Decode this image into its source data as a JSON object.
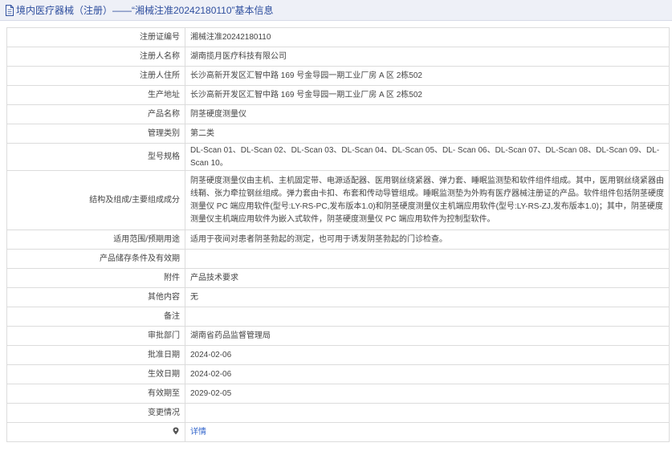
{
  "header": {
    "title": "境内医疗器械（注册）——“湘械注准20242180110”基本信息"
  },
  "rows": [
    {
      "label": "注册证编号",
      "value": "湘械注准20242180110"
    },
    {
      "label": "注册人名称",
      "value": "湖南揽月医疗科技有限公司"
    },
    {
      "label": "注册人住所",
      "value": "长沙高新开发区汇智中路 169 号金导园一期工业厂房 A 区 2栋502"
    },
    {
      "label": "生产地址",
      "value": "长沙高新开发区汇智中路 169 号金导园一期工业厂房 A 区 2栋502"
    },
    {
      "label": "产品名称",
      "value": "阴茎硬度测量仪"
    },
    {
      "label": "管理类别",
      "value": "第二类"
    },
    {
      "label": "型号规格",
      "value": "DL-Scan 01、DL-Scan 02、DL-Scan 03、DL-Scan 04、DL-Scan 05、DL- Scan 06、DL-Scan 07、DL-Scan 08、DL-Scan 09、DL-Scan 10。"
    },
    {
      "label": "结构及组成/主要组成成分",
      "value": "阴茎硬度测量仪由主机、主机固定带、电源适配器、医用钢丝绕紧器、弹力套、睡眠监测垫和软件组件组成。其中，医用钢丝绕紧器由线鞘、张力牵拉钢丝组成。弹力套由卡扣、布套和传动导管组成。睡眠监测垫为外购有医疗器械注册证的产品。软件组件包括阴茎硬度测量仪 PC 端应用软件(型号:LY-RS-PC,发布版本1.0)和阴茎硬度测量仪主机端应用软件(型号:LY-RS-ZJ,发布版本1.0)；其中，阴茎硬度测量仪主机端应用软件为嵌入式软件，阴茎硬度测量仪 PC 端应用软件为控制型软件。"
    },
    {
      "label": "适用范围/预期用途",
      "value": "适用于夜间对患者阴茎勃起的测定，也可用于诱发阴茎勃起的门诊检查。"
    },
    {
      "label": "产品储存条件及有效期",
      "value": ""
    },
    {
      "label": "附件",
      "value": "产品技术要求"
    },
    {
      "label": "其他内容",
      "value": "无"
    },
    {
      "label": "备注",
      "value": ""
    },
    {
      "label": "审批部门",
      "value": "湖南省药品监督管理局"
    },
    {
      "label": "批准日期",
      "value": "2024-02-06"
    },
    {
      "label": "生效日期",
      "value": "2024-02-06"
    },
    {
      "label": "有效期至",
      "value": "2029-02-05"
    },
    {
      "label": "变更情况",
      "value": ""
    },
    {
      "label": "",
      "value": "详情",
      "icon": "location-pin-icon"
    }
  ],
  "colors": {
    "title_text": "#2e4e9e",
    "title_bg": "#eef0f7",
    "link": "#3366cc",
    "border": "#dcdcdc"
  }
}
